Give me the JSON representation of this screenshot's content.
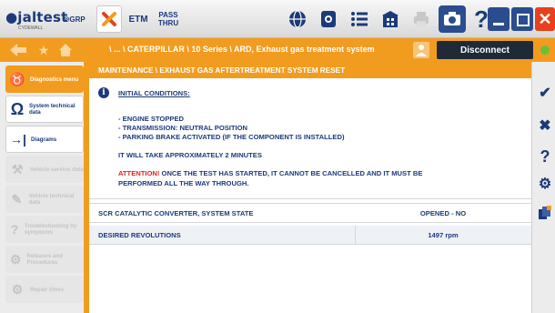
{
  "app": {
    "logo": "jaltest",
    "logo_sub": "CYDEWALL"
  },
  "toolbar": {
    "grp_label": "GRP",
    "etm_label": "ETM",
    "pass_line1": "PASS",
    "pass_line2": "THRU",
    "icons": [
      "globe-icon",
      "gear-screen-icon",
      "list-icon",
      "building-icon",
      "printer-icon",
      "camera-icon",
      "help-icon"
    ],
    "close_glyph": "✕"
  },
  "nav": {
    "breadcrumb": "\\ ... \\ CATERPILLAR \\ 10 Series \\ ARD, Exhaust gas treatment system",
    "disconnect_label": "Disconnect"
  },
  "sidebar": {
    "items": [
      {
        "label": "Diagnostics menu",
        "state": "active"
      },
      {
        "label": "System technical data",
        "state": "enabled"
      },
      {
        "label": "Diagrams",
        "state": "enabled"
      },
      {
        "label": "Vehicle service data",
        "state": "disabled"
      },
      {
        "label": "Vehicle technical data",
        "state": "disabled"
      },
      {
        "label": "Troubleshooting by symptoms",
        "state": "disabled"
      },
      {
        "label": "Releases and Procedures",
        "state": "disabled"
      },
      {
        "label": "Repair times",
        "state": "disabled"
      }
    ]
  },
  "main": {
    "title": "MAINTENANCE \\ EXHAUST GAS AFTERTREATMENT SYSTEM RESET",
    "conditions_heading": "INITIAL CONDITIONS:",
    "conditions": [
      "- ENGINE STOPPED",
      "- TRANSMISSION: NEUTRAL POSITION",
      "- PARKING BRAKE ACTIVATED (IF THE COMPONENT IS INSTALLED)"
    ],
    "duration_note": "IT WILL TAKE APPROXIMATELY 2 MINUTES",
    "attention_label": "ATTENTION!",
    "attention_line1": " ONCE THE TEST HAS STARTED, IT CANNOT BE CANCELLED AND IT MUST BE",
    "attention_line2": "PERFORMED ALL THE WAY THROUGH.",
    "rows": [
      {
        "label": "SCR CATALYTIC CONVERTER, SYSTEM STATE",
        "value": "OPENED - NO"
      },
      {
        "label": "DESIRED REVOLUTIONS",
        "value": "1497 rpm"
      }
    ]
  },
  "right_toolbar": {
    "buttons": [
      "check-icon",
      "cancel-icon",
      "help-icon",
      "settings-icon",
      "documents-icon"
    ]
  },
  "colors": {
    "accent": "#f29c1f",
    "brand": "#1b3a7a",
    "attention": "#e02020",
    "close": "#e8401c"
  }
}
